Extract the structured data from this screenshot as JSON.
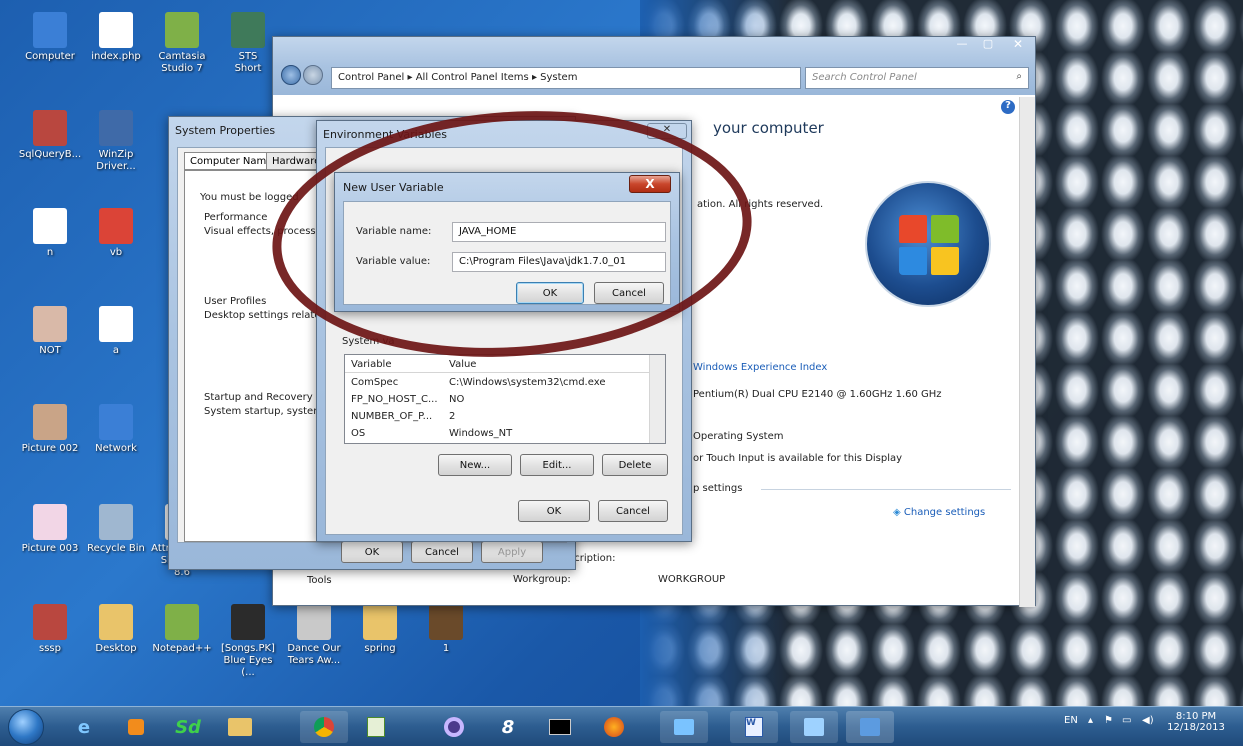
{
  "desktop_icons": [
    {
      "label": "Computer"
    },
    {
      "label": "index.php"
    },
    {
      "label": "Camtasia\nStudio 7"
    },
    {
      "label": "STS\nShort"
    },
    {
      "label": "SqlQueryB..."
    },
    {
      "label": "WinZip\nDriver..."
    },
    {
      "label": "n"
    },
    {
      "label": "vb"
    },
    {
      "label": "NOT"
    },
    {
      "label": "a"
    },
    {
      "label": "Picture 002"
    },
    {
      "label": "Network"
    },
    {
      "label": "Picture 003"
    },
    {
      "label": "Recycle Bin"
    },
    {
      "label": "Attrinspect - Shortcut\n8.6"
    },
    {
      "label": "sssp"
    },
    {
      "label": "Desktop"
    },
    {
      "label": "Notepad++"
    },
    {
      "label": "[Songs.PK]\nBlue Eyes (..."
    },
    {
      "label": "Dance Our\nTears Aw..."
    },
    {
      "label": "spring"
    },
    {
      "label": "1"
    }
  ],
  "control_panel": {
    "breadcrumb": [
      "Control Panel",
      "All Control Panel Items",
      "System"
    ],
    "search_placeholder": "Search Control Panel",
    "heading": "your computer",
    "copyright": "ation.  All rights reserved.",
    "experience_index": "Windows Experience Index",
    "processor": "Pentium(R) Dual  CPU  E2140  @ 1.60GHz  1.60 GHz",
    "system_type": "Operating System",
    "pen_touch": "or Touch Input is available for this Display",
    "settings_header": "p settings",
    "change_settings": "Change settings",
    "desc_label": "scription:",
    "workgroup_label": "Workgroup:",
    "workgroup_value": "WORKGROUP",
    "tools_label": "Tools"
  },
  "system_properties": {
    "title": "System Properties",
    "tabs": [
      "Computer Name",
      "Hardware"
    ],
    "logged_text": "You must be logged",
    "performance_label": "Performance",
    "performance_desc": "Visual effects, processor",
    "profiles_label": "User Profiles",
    "profiles_desc": "Desktop settings related",
    "startup_label": "Startup and Recovery",
    "startup_desc": "System startup, system fa",
    "ok": "OK",
    "cancel": "Cancel",
    "apply": "Apply"
  },
  "environment_variables": {
    "title": "Environment Variables",
    "system_vars_label": "System va",
    "columns": [
      "Variable",
      "Value"
    ],
    "rows": [
      {
        "variable": "ComSpec",
        "value": "C:\\Windows\\system32\\cmd.exe"
      },
      {
        "variable": "FP_NO_HOST_C...",
        "value": "NO"
      },
      {
        "variable": "NUMBER_OF_P...",
        "value": "2"
      },
      {
        "variable": "OS",
        "value": "Windows_NT"
      }
    ],
    "new": "New...",
    "edit": "Edit...",
    "delete": "Delete",
    "ok": "OK",
    "cancel": "Cancel"
  },
  "new_user_variable": {
    "title": "New User Variable",
    "name_label": "Variable name:",
    "name_value": "JAVA_HOME",
    "value_label": "Variable value:",
    "value_value": "C:\\Program Files\\Java\\jdk1.7.0_01",
    "ok": "OK",
    "cancel": "Cancel",
    "close": "X"
  },
  "taskbar": {
    "lang": "EN",
    "time": "8:10 PM",
    "date": "12/18/2013"
  }
}
